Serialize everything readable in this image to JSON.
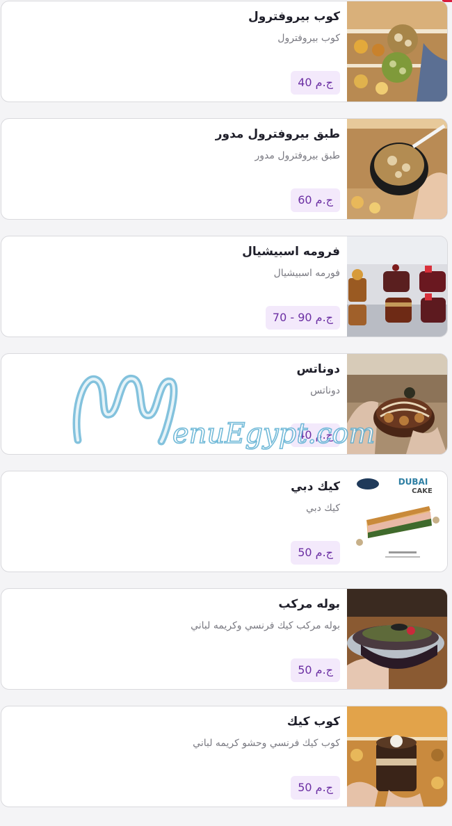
{
  "menu": {
    "items": [
      {
        "title": "كوب بيروفترول",
        "description": "كوب بيروفترول",
        "price": "40 ج.م",
        "photo": "profiterole-cup-photo"
      },
      {
        "title": "طبق بيروفترول مدور",
        "description": "طبق بيروفترول مدور",
        "price": "60 ج.م",
        "photo": "round-profiterole-plate-photo"
      },
      {
        "title": "فرومه اسبيشيال",
        "description": "فورمه اسبيشيال",
        "price": "70 - 90 ج.م",
        "photo": "special-cakes-photo"
      },
      {
        "title": "دوناتس",
        "description": "دوناتس",
        "price": "40 ج.م",
        "photo": "donuts-photo"
      },
      {
        "title": "كيك دبي",
        "description": "كيك دبي",
        "price": "50 ج.م",
        "photo": "dubai-cake-photo"
      },
      {
        "title": "بوله مركب",
        "description": "بوله مركب كيك فرنسي وكريمه لباني",
        "price": "50 ج.م",
        "photo": "bowl-cake-photo"
      },
      {
        "title": "كوب كيك",
        "description": "كوب كيك فرنسي وحشو كريمه لباني",
        "price": "50 ج.م",
        "photo": "cup-cake-photo"
      }
    ],
    "dubai_photo_heading": [
      "DUBAI",
      "CAKE"
    ]
  },
  "watermark": {
    "text": "MenuEgypt.com"
  },
  "colors": {
    "accent": "#d81b3c",
    "price_bg": "#f3e9fb",
    "price_text": "#6b2fa3",
    "watermark": "#4aa3c8"
  }
}
